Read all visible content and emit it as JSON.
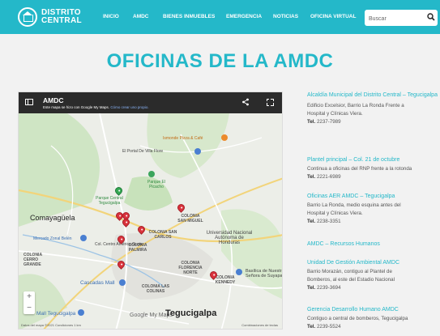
{
  "header": {
    "logo_line1": "DISTRITO",
    "logo_line2": "CENTRAL",
    "nav": [
      "INICIO",
      "AMDC",
      "BIENES INMUEBLES",
      "EMERGENCIA",
      "NOTICIAS",
      "OFICINA VIRTUAL"
    ],
    "search_placeholder": "Buscar",
    "accent": "#24b8c9"
  },
  "page_title": "OFICINAS DE LA AMDC",
  "map": {
    "name": "AMDC",
    "note_text": "Este mapa se hizo con Google My Maps.",
    "note_link": "Cómo crear uno propio.",
    "labels": {
      "la_cumbre": "Comayagüela",
      "la_leona": "El Portal De Villa Flore",
      "pizza": "Ismonde Pizza & Café",
      "parque_picacho": "Parque El Picacho",
      "parque_central": "Parque Central Tegucigalpa",
      "comayaguela": "Comayagüela",
      "mercado": "Mercado Zonal Belén",
      "col_san_carlos": "COLONIA SAN CARLOS",
      "col_san_miguel": "COLONIA SAN MIGUEL",
      "col_palmira": "COLONIA PALMIRA",
      "col_florencia": "COLONIA FLORENCIA NORTE",
      "col_kennedy": "COLONIA KENNEDY",
      "col_las_colinas": "COLONIA LAS COLINAS",
      "unah": "Universidad Nacional Autónoma de Honduras",
      "basilica": "Basílica de Nuestra Señora de Suyapa",
      "cascadas": "Cascadas Mall",
      "mall": "Mall Tegucigalpa",
      "tegucigalpa": "Tegucigalpa",
      "col_cerro_grande": "COLONIA CERRO GRANDE",
      "ccentral": "Col. Centro América Oeste"
    },
    "zoom_in": "+",
    "zoom_out": "−",
    "google": "Google My Maps",
    "footer_left": "Datos del mapa ©2021   Condiciones   1 km",
    "footer_right": "Combinaciones de teclas"
  },
  "offices": [
    {
      "title": "Alcaldía Municipal del Distrito Central – Tegucigalpa",
      "addr": [
        "Edificio Excelsior, Barrio La Ronda Frente a",
        "Hospital y Clínicas Viera."
      ],
      "tel_label": "Tel.",
      "tel": "2237-7989"
    },
    {
      "title": "Plantel principal – Col. 21 de octubre",
      "addr": [
        "Continua a oficinas del RNP frente a la rotonda"
      ],
      "tel_label": "Tel.",
      "tel": "2221-6989"
    },
    {
      "title": "Oficinas AER AMDC – Tegucigalpa",
      "addr": [
        "Barrio La Ronda, medio esquina antes del",
        "Hospital y Clínicas Viera."
      ],
      "tel_label": "Tel.",
      "tel": "2238-3351"
    },
    {
      "title": "AMDC – Recursos Humanos",
      "addr": [],
      "tel_label": "",
      "tel": ""
    },
    {
      "title": "Unidad De Gestión Ambiental AMDC",
      "addr": [
        "Barrio Morazán, contiguo al Plantel de",
        "Bomberos, al este del Estadio Nacional"
      ],
      "tel_label": "Tel.",
      "tel": "2239-3694"
    },
    {
      "title": "Gerencia Desarrollo Humano AMDC",
      "addr": [
        "Contiguo a central de bomberos, Tegucigalpa"
      ],
      "tel_label": "Tel.",
      "tel": "2239-5524"
    }
  ]
}
